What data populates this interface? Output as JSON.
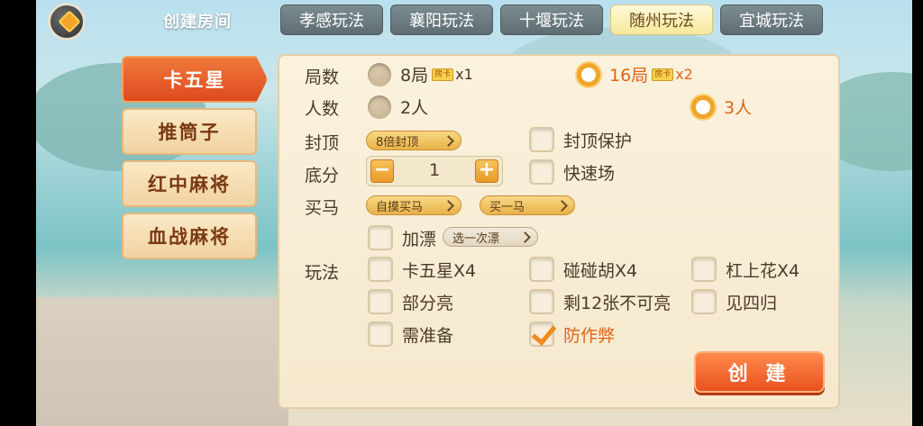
{
  "header": {
    "back_icon": "back-arrow-icon",
    "title": "创建房间",
    "tabs": [
      {
        "label": "孝感玩法",
        "active": false
      },
      {
        "label": "襄阳玩法",
        "active": false
      },
      {
        "label": "十堰玩法",
        "active": false
      },
      {
        "label": "随州玩法",
        "active": true
      },
      {
        "label": "宜城玩法",
        "active": false
      }
    ]
  },
  "sidebar": {
    "items": [
      {
        "label": "卡五星",
        "active": true
      },
      {
        "label": "推筒子",
        "active": false
      },
      {
        "label": "红中麻将",
        "active": false
      },
      {
        "label": "血战麻将",
        "active": false
      }
    ]
  },
  "form": {
    "rounds": {
      "label": "局数",
      "options": [
        {
          "text": "8局",
          "badge": "房卡",
          "mult": "x1",
          "selected": false
        },
        {
          "text": "16局",
          "badge": "房卡",
          "mult": "x2",
          "selected": true
        }
      ]
    },
    "players": {
      "label": "人数",
      "options": [
        {
          "text": "2人",
          "selected": false
        },
        {
          "text": "3人",
          "selected": true
        }
      ]
    },
    "cap": {
      "label": "封顶",
      "select_value": "8倍封顶",
      "protect_label": "封顶保护",
      "protect_checked": false
    },
    "base": {
      "label": "底分",
      "value": "1",
      "minus": "−",
      "plus": "+",
      "fast_label": "快速场",
      "fast_checked": false
    },
    "horse": {
      "label": "买马",
      "mode_value": "自摸买马",
      "count_value": "买一马"
    },
    "float": {
      "label": "加漂",
      "checked": false,
      "select_value": "选一次漂"
    },
    "rules": {
      "label": "玩法",
      "items": [
        {
          "text": "卡五星X4",
          "checked": false
        },
        {
          "text": "碰碰胡X4",
          "checked": false
        },
        {
          "text": "杠上花X4",
          "checked": false
        },
        {
          "text": "部分亮",
          "checked": false
        },
        {
          "text": "剩12张不可亮",
          "checked": false
        },
        {
          "text": "见四归",
          "checked": false
        },
        {
          "text": "需准备",
          "checked": false
        },
        {
          "text": "防作弊",
          "checked": true
        }
      ]
    }
  },
  "create_button": "创 建",
  "colors": {
    "accent": "#f0a52a",
    "active_tab": "#f6e89d",
    "sidebar_active": "#dd4a1d",
    "selected_text": "#e0641a"
  }
}
